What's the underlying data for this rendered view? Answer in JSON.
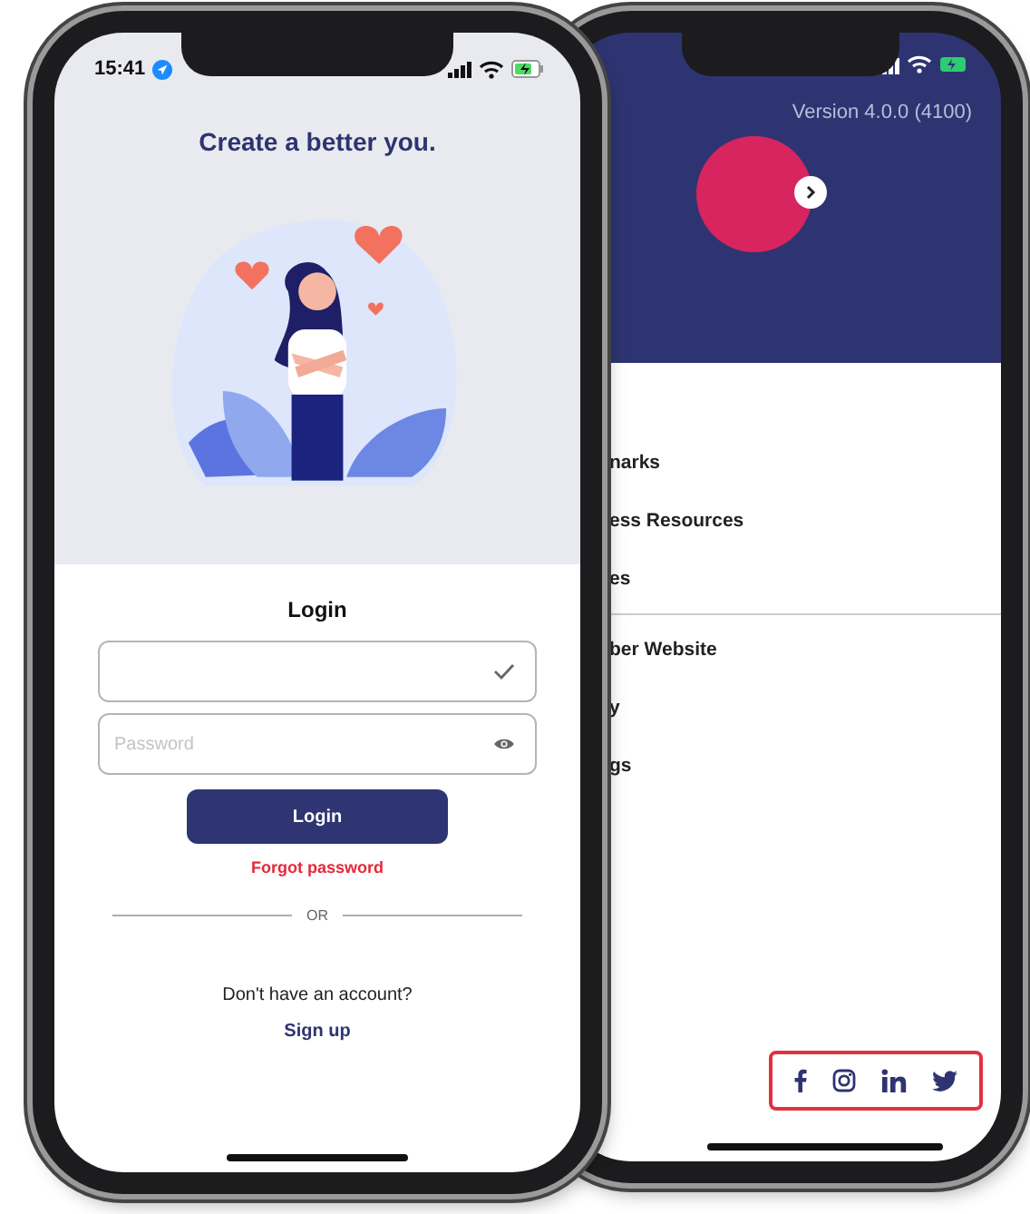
{
  "left_screen": {
    "status_bar": {
      "time": "15:41"
    },
    "title": "Create a better you.",
    "login": {
      "heading": "Login",
      "username_field": {
        "validated": true
      },
      "password_field": {
        "placeholder": "Password"
      },
      "login_button": "Login",
      "forgot_link": "Forgot password",
      "divider": "OR",
      "signup_prompt": "Don't have an account?",
      "signup_link": "Sign up"
    }
  },
  "right_screen": {
    "version": "Version 4.0.0 (4100)",
    "menu_sections": [
      [
        {
          "label": "narks"
        },
        {
          "label": "ess Resources"
        },
        {
          "label": "es"
        }
      ],
      [
        {
          "label": "ber Website"
        },
        {
          "label": "y"
        },
        {
          "label": "gs"
        }
      ]
    ],
    "social_links": [
      {
        "kind": "facebook"
      },
      {
        "kind": "instagram"
      },
      {
        "kind": "linkedin"
      },
      {
        "kind": "twitter"
      }
    ],
    "social_highlighted": true
  }
}
